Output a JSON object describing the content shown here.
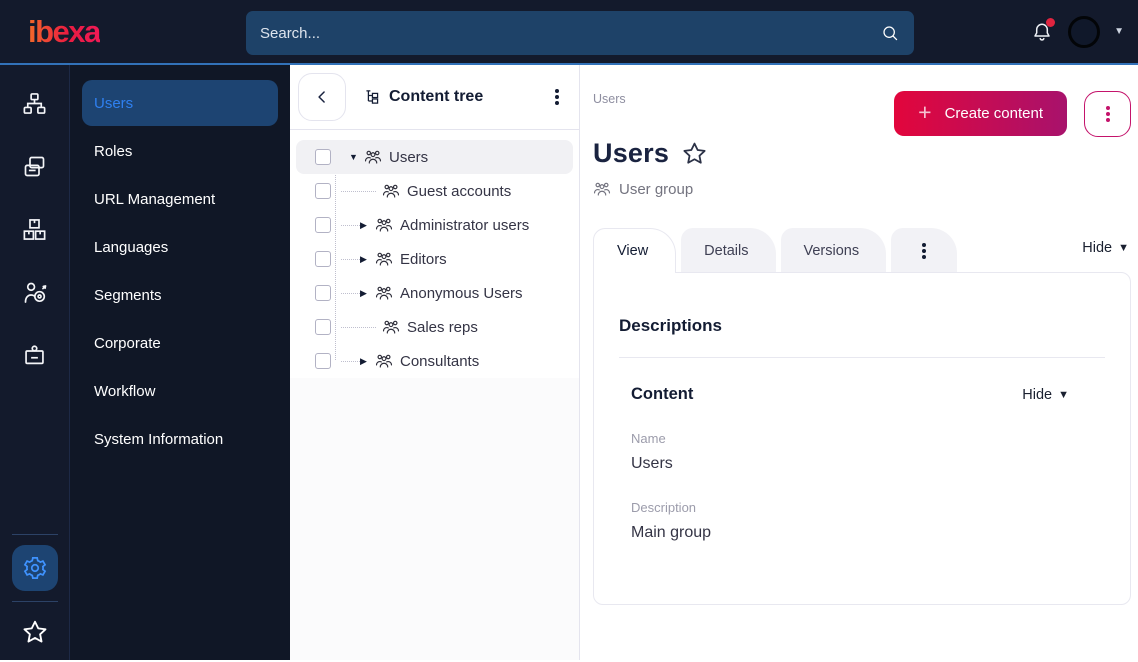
{
  "topbar": {
    "logo_text": "ibexa",
    "search_placeholder": "Search...",
    "notification_badge": true
  },
  "colors": {
    "topbar_bg": "#131a2c",
    "accent_line": "#3272b9",
    "sidebar_selected_bg": "#1d4472",
    "selected_blue": "#2f80f0",
    "brand_gradient_start": "#e2063c",
    "brand_gradient_end": "#a8126c"
  },
  "rail": {
    "icons": [
      "sitemap-icon",
      "pages-icon",
      "product-catalog-icon",
      "personalization-icon",
      "id-badge-icon",
      "settings-gear-icon",
      "favorites-star-icon"
    ]
  },
  "sidebar": {
    "items": [
      {
        "label": "Users",
        "active": true
      },
      {
        "label": "Roles"
      },
      {
        "label": "URL Management"
      },
      {
        "label": "Languages"
      },
      {
        "label": "Segments"
      },
      {
        "label": "Corporate"
      },
      {
        "label": "Workflow"
      },
      {
        "label": "System Information"
      }
    ]
  },
  "content_tree": {
    "title": "Content tree",
    "items": [
      {
        "label": "Users",
        "caret": "▼",
        "selected": true,
        "level": 0
      },
      {
        "label": "Guest accounts",
        "caret": "",
        "level": 1
      },
      {
        "label": "Administrator users",
        "caret": "▶",
        "level": 1
      },
      {
        "label": "Editors",
        "caret": "▶",
        "level": 1
      },
      {
        "label": "Anonymous Users",
        "caret": "▶",
        "level": 1
      },
      {
        "label": "Sales reps",
        "caret": "",
        "level": 1
      },
      {
        "label": "Consultants",
        "caret": "▶",
        "level": 1
      }
    ]
  },
  "main": {
    "breadcrumb": "Users",
    "create_button_label": "Create content",
    "page_title": "Users",
    "content_type": "User group",
    "tabs": [
      "View",
      "Details",
      "Versions"
    ],
    "hide_label": "Hide",
    "card": {
      "heading": "Descriptions",
      "section_title": "Content",
      "section_hide_label": "Hide",
      "fields": [
        {
          "label": "Name",
          "value": "Users"
        },
        {
          "label": "Description",
          "value": "Main group"
        }
      ]
    }
  }
}
